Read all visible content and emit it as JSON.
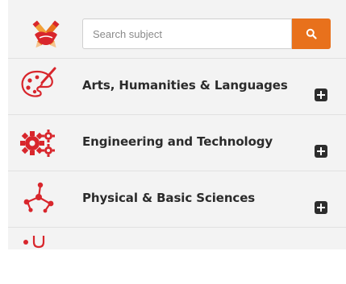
{
  "search": {
    "placeholder": "Search subject",
    "button_icon": "search-icon"
  },
  "logo": {
    "icon": "handshake-pencil-logo"
  },
  "categories": [
    {
      "label": "Arts, Humanities & Languages",
      "icon": "palette-icon",
      "toggle_icon": "plus-icon"
    },
    {
      "label": "Engineering and Technology",
      "icon": "gears-icon",
      "toggle_icon": "plus-icon"
    },
    {
      "label": "Physical & Basic Sciences",
      "icon": "molecule-icon",
      "toggle_icon": "plus-icon"
    },
    {
      "label": "",
      "icon": "stethoscope-icon",
      "toggle_icon": ""
    }
  ],
  "colors": {
    "accent": "#e8711c",
    "icon_red": "#d8262c",
    "text": "#2b2b2b",
    "panel_bg": "#f3f3f3"
  }
}
